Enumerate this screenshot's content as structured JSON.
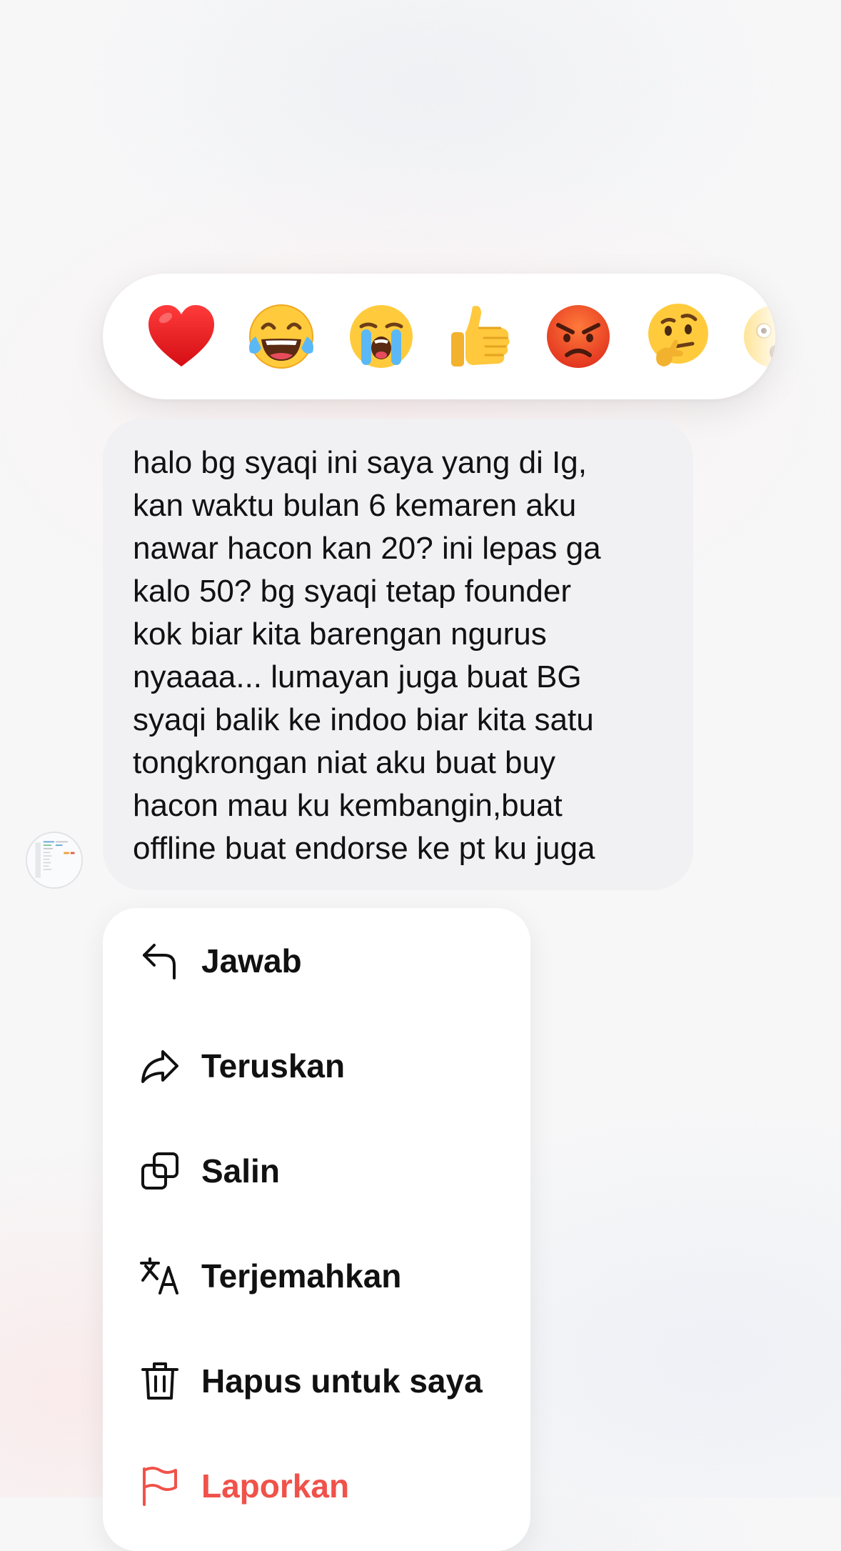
{
  "reactions": [
    {
      "icon": "red-heart-emoji",
      "label": "❤️"
    },
    {
      "icon": "tears-of-joy-emoji",
      "label": "😂"
    },
    {
      "icon": "loudly-crying-emoji",
      "label": "😭"
    },
    {
      "icon": "thumbs-up-emoji",
      "label": "👍"
    },
    {
      "icon": "angry-face-emoji",
      "label": "😡"
    },
    {
      "icon": "thinking-face-emoji",
      "label": "🤔"
    },
    {
      "icon": "astonished-face-emoji",
      "label": "😮"
    }
  ],
  "message": {
    "lines": [
      "halo bg syaqi ini saya yang di Ig,",
      "kan waktu bulan 6 kemaren aku",
      "nawar hacon kan 20? ini lepas ga",
      "kalo 50? bg syaqi tetap founder",
      "kok biar kita barengan ngurus",
      "nyaaaa... lumayan juga buat BG",
      "syaqi balik ke indoo biar kita satu",
      "tongkrongan niat aku buat buy",
      "hacon mau ku kembangin,buat",
      "offline buat endorse ke pt ku juga"
    ]
  },
  "menu": {
    "items": [
      {
        "label": "Jawab",
        "icon": "reply-icon"
      },
      {
        "label": "Teruskan",
        "icon": "forward-icon"
      },
      {
        "label": "Salin",
        "icon": "copy-icon"
      },
      {
        "label": "Terjemahkan",
        "icon": "translate-icon"
      },
      {
        "label": "Hapus untuk saya",
        "icon": "trash-icon"
      },
      {
        "label": "Laporkan",
        "icon": "flag-icon",
        "color": "#f0524a"
      }
    ]
  }
}
